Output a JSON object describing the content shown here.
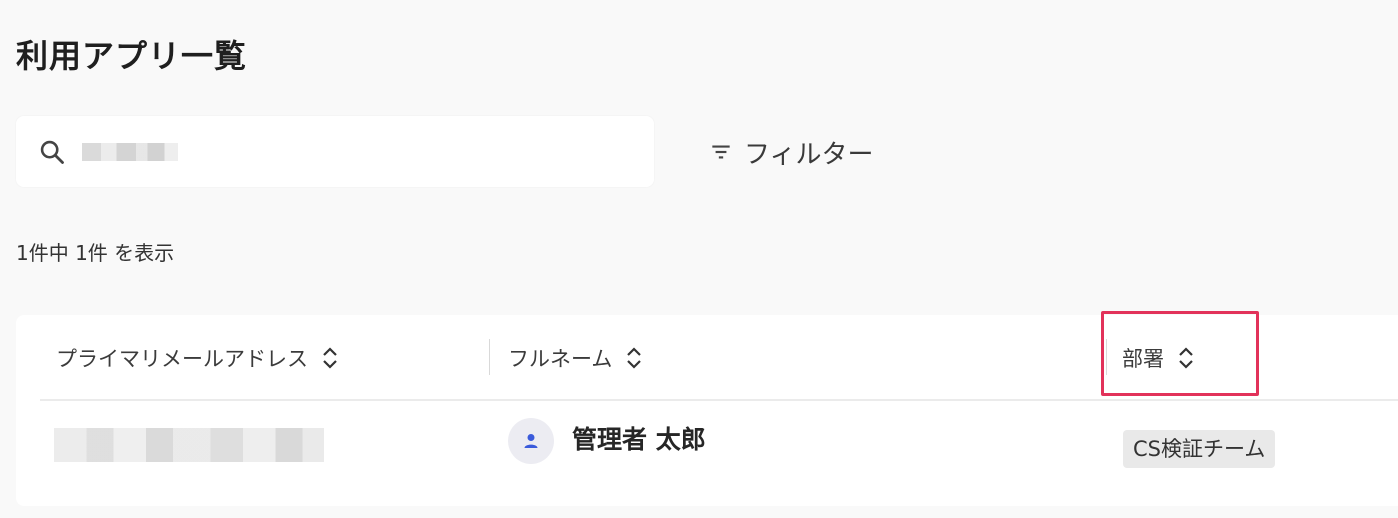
{
  "page": {
    "title": "利用アプリ一覧"
  },
  "search": {
    "value": "",
    "icon": "search-icon"
  },
  "filter": {
    "label": "フィルター",
    "icon": "filter-icon"
  },
  "results": {
    "summary": "1件中 1件 を表示"
  },
  "table": {
    "columns": [
      {
        "label": "プライマリメールアドレス",
        "sort_icon": "sort-icon"
      },
      {
        "label": "フルネーム",
        "sort_icon": "sort-icon"
      },
      {
        "label": "部署",
        "sort_icon": "sort-icon"
      }
    ],
    "rows": [
      {
        "email": "",
        "full_name": "管理者 太郎",
        "department": "CS検証チーム",
        "avatar_icon": "user-icon"
      }
    ]
  },
  "colors": {
    "background": "#f9f9f9",
    "highlight": "#e2325a",
    "avatar_icon": "#3b5bdb",
    "chip_background": "#e9e9e9"
  }
}
